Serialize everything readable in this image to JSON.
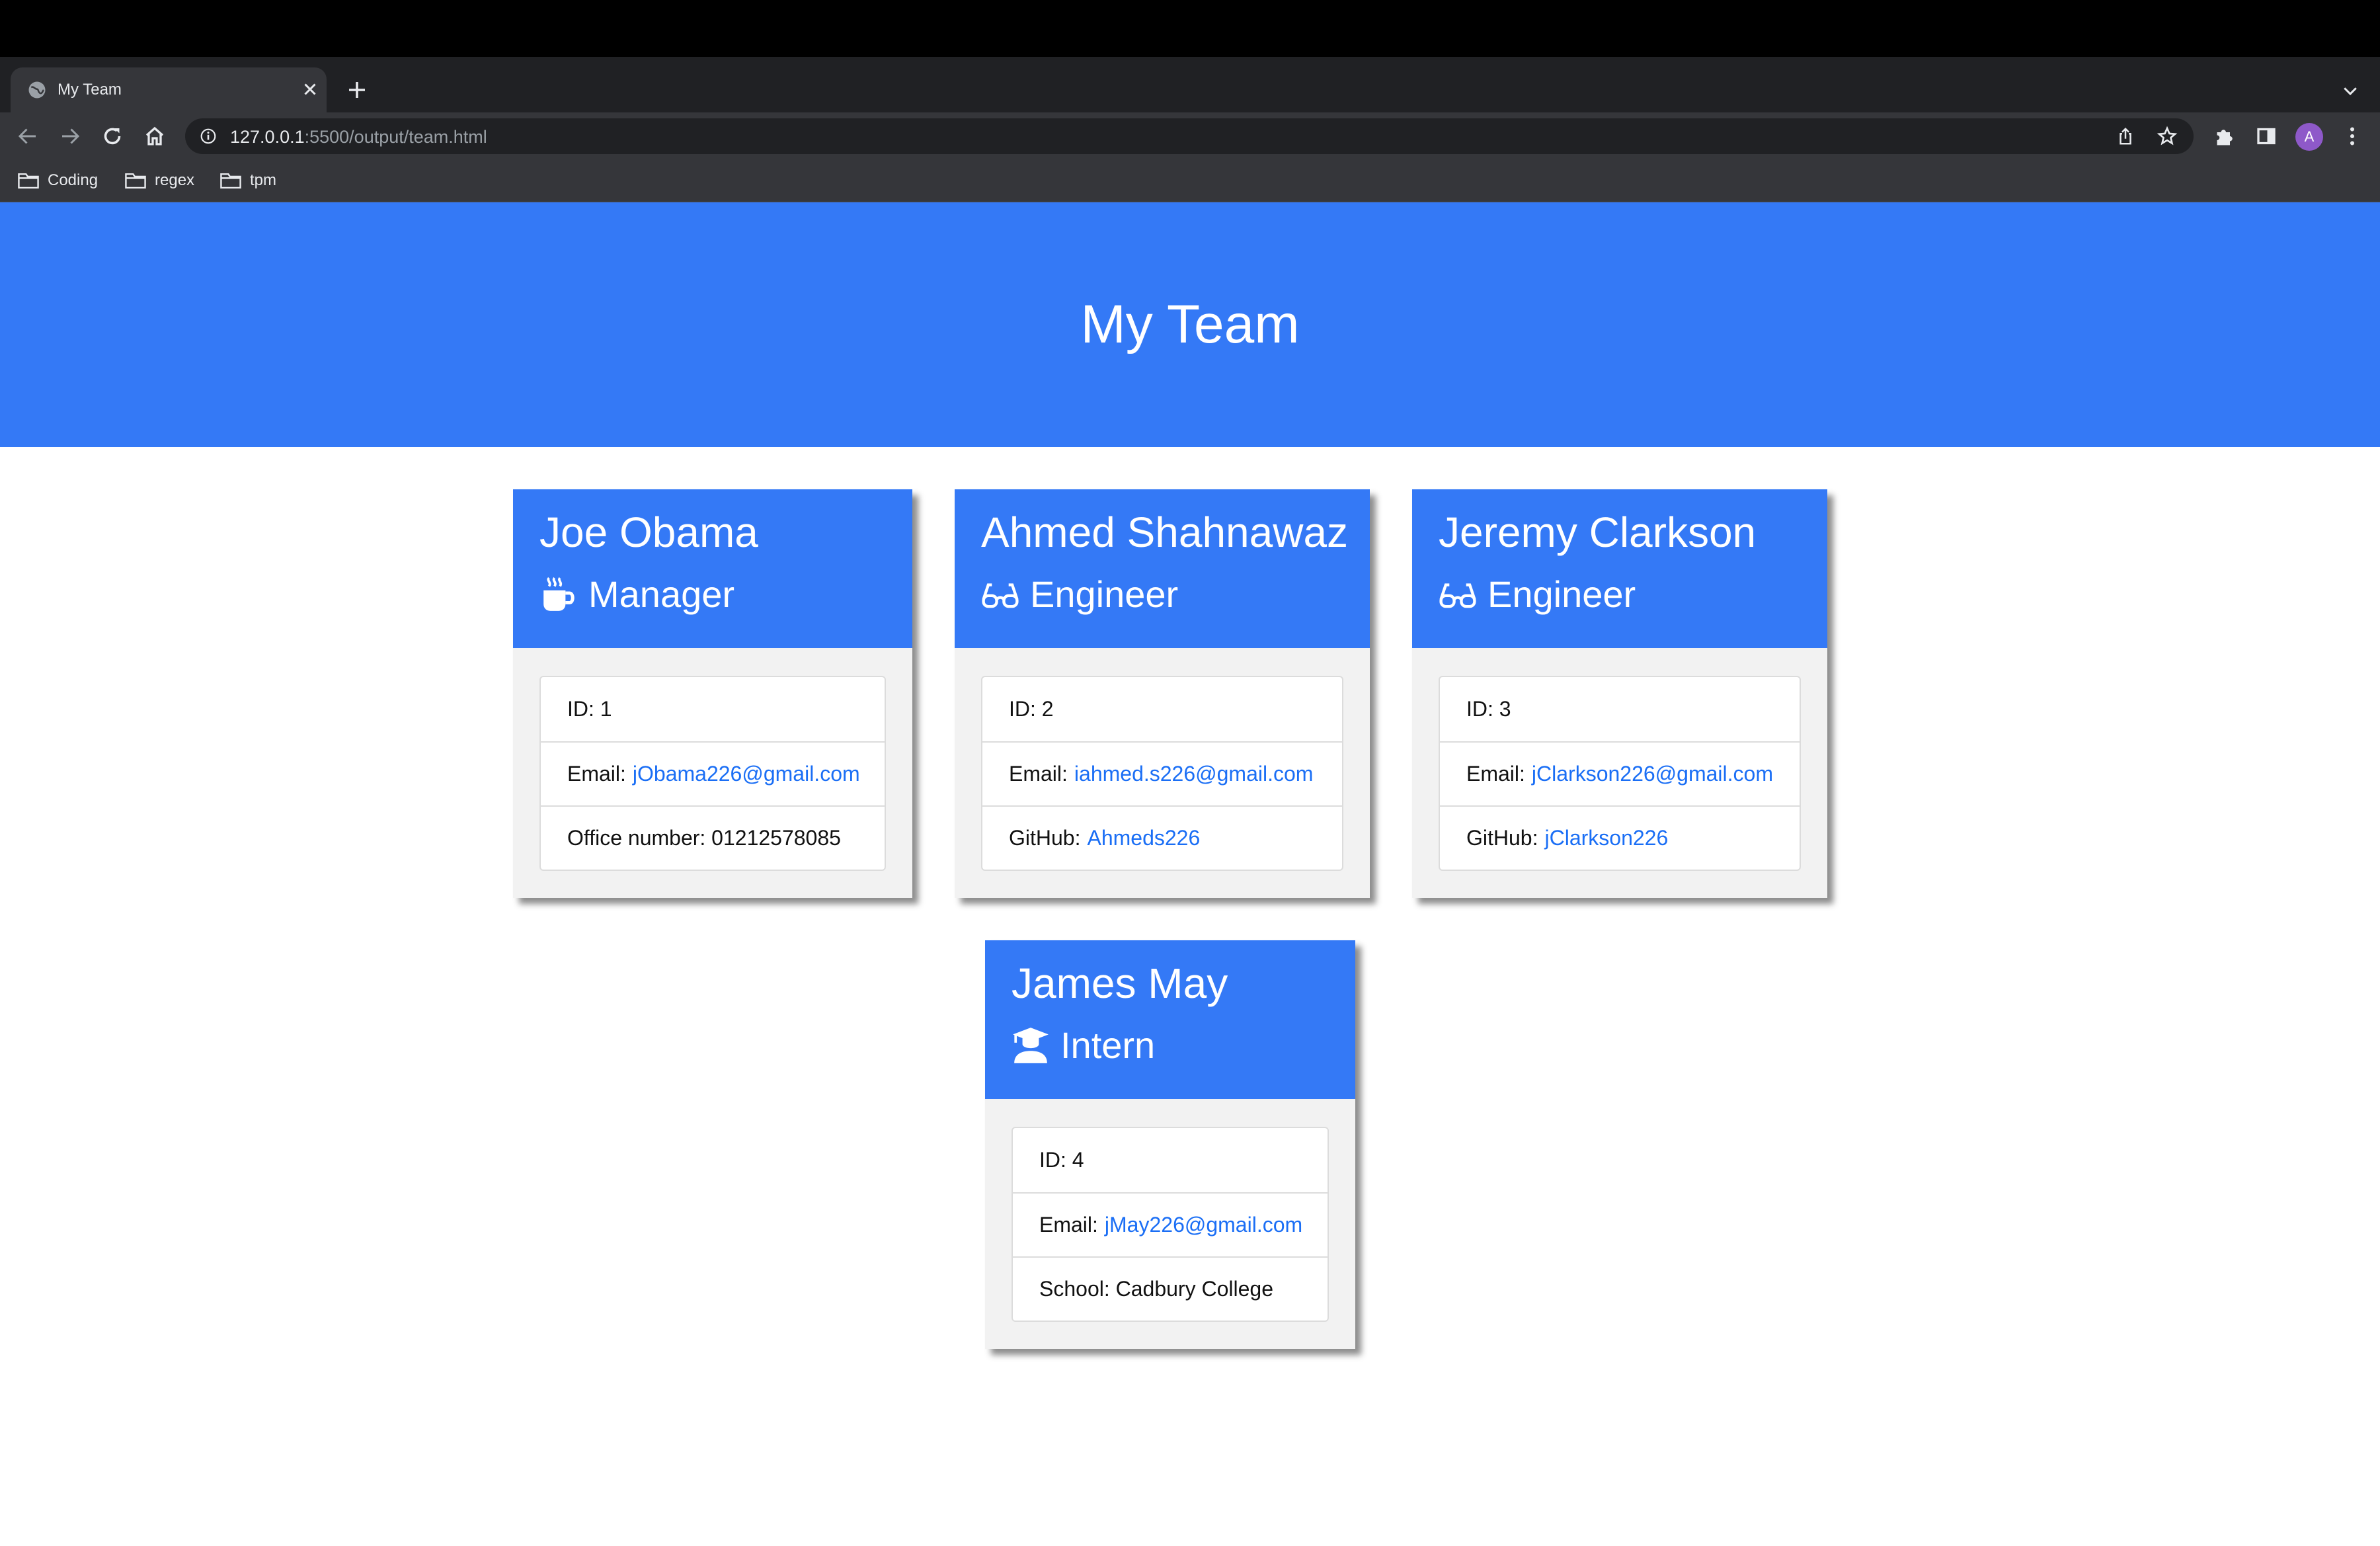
{
  "browser": {
    "tab_title": "My Team",
    "url_host": "127.0.0.1",
    "url_rest": ":5500/output/team.html",
    "profile_initial": "A",
    "bookmarks": [
      "Coding",
      "regex",
      "tpm"
    ]
  },
  "page": {
    "title": "My Team",
    "accent_color": "#3479f6",
    "link_color": "#1a6ef5"
  },
  "team": [
    {
      "name": "Joe Obama",
      "role": "Manager",
      "role_icon": "coffee-mug-icon",
      "id_label": "ID: 1",
      "email_label": "Email:",
      "email": "jObama226@gmail.com",
      "extra_label": "Office number: 01212578085",
      "extra_value": ""
    },
    {
      "name": "Ahmed Shahnawaz",
      "role": "Engineer",
      "role_icon": "glasses-icon",
      "id_label": "ID: 2",
      "email_label": "Email:",
      "email": "iahmed.s226@gmail.com",
      "extra_label": "GitHub:",
      "extra_value": "Ahmeds226"
    },
    {
      "name": "Jeremy Clarkson",
      "role": "Engineer",
      "role_icon": "glasses-icon",
      "id_label": "ID: 3",
      "email_label": "Email:",
      "email": "jClarkson226@gmail.com",
      "extra_label": "GitHub:",
      "extra_value": "jClarkson226"
    },
    {
      "name": "James May",
      "role": "Intern",
      "role_icon": "graduate-icon",
      "id_label": "ID: 4",
      "email_label": "Email:",
      "email": "jMay226@gmail.com",
      "extra_label": "School: Cadbury College",
      "extra_value": ""
    }
  ]
}
